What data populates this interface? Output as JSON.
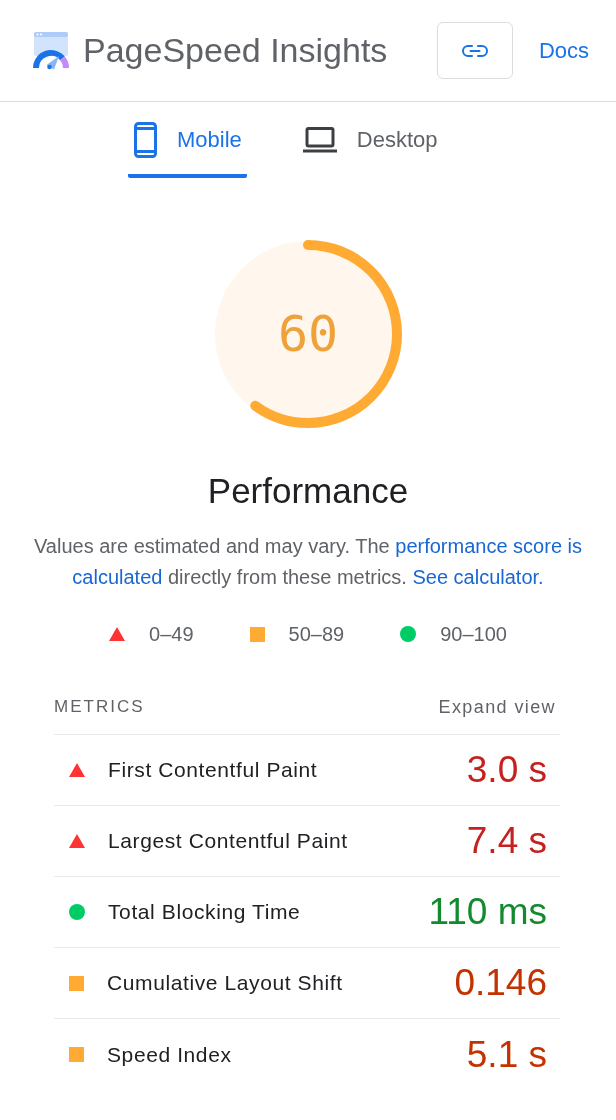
{
  "header": {
    "title": "PageSpeed Insights",
    "docs_link": "Docs"
  },
  "tabs": [
    {
      "kind": "mobile",
      "label": "Mobile",
      "selected": true
    },
    {
      "kind": "desktop",
      "label": "Desktop",
      "selected": false
    }
  ],
  "gauge": {
    "kind": "average",
    "score": "60",
    "level": 0.6,
    "title": "Performance"
  },
  "description": {
    "lines": [
      [
        {
          "kind": "text",
          "text": "Values are estimated and may vary. The "
        },
        {
          "kind": "link",
          "text": "performance score is"
        }
      ],
      [
        {
          "kind": "link",
          "text": "calculated"
        },
        {
          "kind": "text",
          "text": " directly from these metrics. "
        },
        {
          "kind": "link",
          "text": "See calculator."
        }
      ]
    ]
  },
  "legend": [
    {
      "kind": "fail",
      "range": "0–49"
    },
    {
      "kind": "average",
      "range": "50–89"
    },
    {
      "kind": "pass",
      "range": "90–100"
    }
  ],
  "metrics": {
    "heading": "METRICS",
    "toggle": "Expand view",
    "rows": [
      {
        "kind": "fail",
        "label": "First Contentful Paint",
        "value": "3.0 s"
      },
      {
        "kind": "fail",
        "label": "Largest Contentful Paint",
        "value": "7.4 s"
      },
      {
        "kind": "pass",
        "label": "Total Blocking Time",
        "value": "110 ms"
      },
      {
        "kind": "average",
        "label": "Cumulative Layout Shift",
        "value": "0.146"
      },
      {
        "kind": "average",
        "label": "Speed Index",
        "value": "5.1 s"
      }
    ]
  }
}
